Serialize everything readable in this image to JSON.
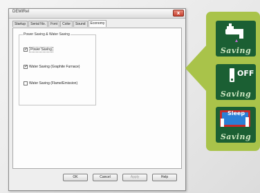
{
  "window": {
    "title": "DEMIRel",
    "close_label": "x"
  },
  "tabs": [
    "Startup",
    "Serial No.",
    "Font",
    "Color",
    "Sound",
    "Economy"
  ],
  "group": {
    "title": "Power Saving & Water Saving",
    "options": [
      {
        "label": "Power Saving",
        "checked": true
      },
      {
        "label": "Water Saving (Graphite Furnace)",
        "checked": true
      },
      {
        "label": "Water Saving (Flame/Emission)",
        "checked": false
      }
    ]
  },
  "buttons": {
    "ok": "OK",
    "cancel": "Cancel",
    "apply": "Apply",
    "help": "Help"
  },
  "feature_cards": [
    {
      "label": "Saving",
      "icon": "faucet-icon"
    },
    {
      "label": "Saving",
      "icon": "power-off-icon",
      "badge": "OFF"
    },
    {
      "label": "Saving",
      "icon": "sleep-mode-icon",
      "badge": "Sleep"
    }
  ],
  "colors": {
    "callout": "#a9c34a",
    "card": "#1b5f33",
    "card_text": "#cfe8c2"
  }
}
